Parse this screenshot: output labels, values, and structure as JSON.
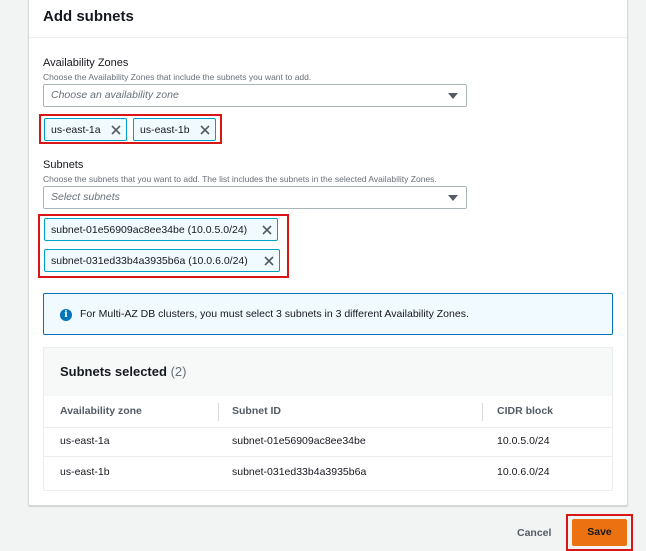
{
  "section": {
    "title": "Add subnets"
  },
  "availability_zones": {
    "label": "Availability Zones",
    "description": "Choose the Availability Zones that include the subnets you want to add.",
    "placeholder": "Choose an availability zone",
    "selected": [
      "us-east-1a",
      "us-east-1b"
    ]
  },
  "subnets": {
    "label": "Subnets",
    "description": "Choose the subnets that you want to add. The list includes the subnets in the selected Availability Zones.",
    "placeholder": "Select subnets",
    "selected": [
      "subnet-01e56909ac8ee34be (10.0.5.0/24)",
      "subnet-031ed33b4a3935b6a (10.0.6.0/24)"
    ]
  },
  "info_alert": {
    "text": "For Multi-AZ DB clusters, you must select 3 subnets in 3 different Availability Zones."
  },
  "selected_table": {
    "title": "Subnets selected",
    "count": "(2)",
    "columns": [
      "Availability zone",
      "Subnet ID",
      "CIDR block"
    ],
    "rows": [
      [
        "us-east-1a",
        "subnet-01e56909ac8ee34be",
        "10.0.5.0/24"
      ],
      [
        "us-east-1b",
        "subnet-031ed33b4a3935b6a",
        "10.0.6.0/24"
      ]
    ]
  },
  "footer": {
    "cancel_label": "Cancel",
    "save_label": "Save"
  },
  "colors": {
    "primary_button": "#ec7211",
    "token_border": "#00a1c9",
    "info_border": "#0073bb",
    "highlight": "#d91515"
  }
}
